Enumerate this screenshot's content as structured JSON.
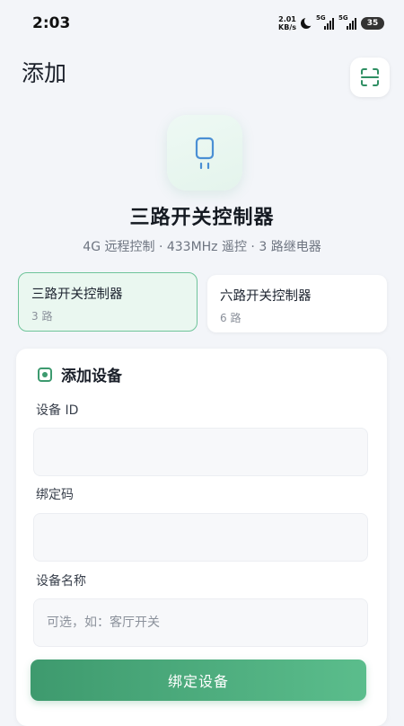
{
  "status_bar": {
    "time": "2:03",
    "net_speed_value": "2.01",
    "net_speed_unit": "KB/s",
    "signal_1_label": "5G",
    "signal_2_label": "5G",
    "battery": "35"
  },
  "header": {
    "title": "添加"
  },
  "device": {
    "name": "三路开关控制器",
    "subtitle": "4G 远程控制 · 433MHz 遥控 · 3 路继电器"
  },
  "device_types": [
    {
      "name": "三路开关控制器",
      "channels": "3 路",
      "selected": true
    },
    {
      "name": "六路开关控制器",
      "channels": "6 路",
      "selected": false
    }
  ],
  "form": {
    "title": "添加设备",
    "device_id_label": "设备 ID",
    "device_id_value": "",
    "bind_code_label": "绑定码",
    "bind_code_value": "",
    "device_name_label": "设备名称",
    "device_name_placeholder": "可选，如：客厅开关",
    "submit_label": "绑定设备"
  },
  "colors": {
    "accent": "#3e9a6e",
    "accent_light": "#eaf7f0",
    "background": "#f3f5f9"
  },
  "icons": [
    "scan-icon",
    "device-plug-icon",
    "moon-icon",
    "signal-icon",
    "battery-icon"
  ]
}
